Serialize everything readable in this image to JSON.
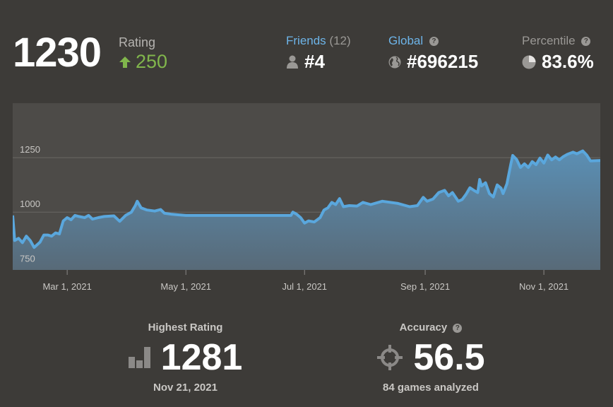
{
  "header": {
    "rating": "1230",
    "rating_label": "Rating",
    "rating_change": "250",
    "friends": {
      "label": "Friends",
      "count": "(12)",
      "value": "#4"
    },
    "global": {
      "label": "Global",
      "value": "#696215"
    },
    "percentile": {
      "label": "Percentile",
      "value": "83.6%"
    }
  },
  "chart_data": {
    "type": "area",
    "xlabel": "",
    "ylabel": "",
    "x_ticks": [
      "Mar 1, 2021",
      "May 1, 2021",
      "Jul 1, 2021",
      "Sep 1, 2021",
      "Nov 1, 2021"
    ],
    "y_ticks": [
      750,
      1000,
      1250
    ],
    "ylim": [
      735,
      1500
    ],
    "xlim": [
      "2021-02-01",
      "2021-11-30"
    ],
    "series": [
      {
        "points": [
          [
            "2021-02-01",
            985
          ],
          [
            "2021-02-02",
            870
          ],
          [
            "2021-02-04",
            880
          ],
          [
            "2021-02-06",
            860
          ],
          [
            "2021-02-08",
            890
          ],
          [
            "2021-02-10",
            870
          ],
          [
            "2021-02-12",
            838
          ],
          [
            "2021-02-15",
            862
          ],
          [
            "2021-02-17",
            895
          ],
          [
            "2021-02-19",
            895
          ],
          [
            "2021-02-21",
            890
          ],
          [
            "2021-02-23",
            905
          ],
          [
            "2021-02-25",
            900
          ],
          [
            "2021-02-27",
            960
          ],
          [
            "2021-03-01",
            975
          ],
          [
            "2021-03-03",
            965
          ],
          [
            "2021-03-05",
            985
          ],
          [
            "2021-03-07",
            980
          ],
          [
            "2021-03-10",
            975
          ],
          [
            "2021-03-12",
            985
          ],
          [
            "2021-03-14",
            968
          ],
          [
            "2021-03-17",
            975
          ],
          [
            "2021-03-20",
            980
          ],
          [
            "2021-03-25",
            983
          ],
          [
            "2021-03-28",
            958
          ],
          [
            "2021-03-31",
            985
          ],
          [
            "2021-04-03",
            1000
          ],
          [
            "2021-04-05",
            1030
          ],
          [
            "2021-04-06",
            1050
          ],
          [
            "2021-04-08",
            1020
          ],
          [
            "2021-04-11",
            1010
          ],
          [
            "2021-04-15",
            1005
          ],
          [
            "2021-04-18",
            1012
          ],
          [
            "2021-04-20",
            995
          ],
          [
            "2021-04-24",
            990
          ],
          [
            "2021-05-01",
            985
          ],
          [
            "2021-06-01",
            985
          ],
          [
            "2021-06-24",
            985
          ],
          [
            "2021-06-25",
            1000
          ],
          [
            "2021-06-27",
            990
          ],
          [
            "2021-06-29",
            975
          ],
          [
            "2021-07-01",
            950
          ],
          [
            "2021-07-03",
            960
          ],
          [
            "2021-07-06",
            955
          ],
          [
            "2021-07-09",
            975
          ],
          [
            "2021-07-11",
            1010
          ],
          [
            "2021-07-13",
            1020
          ],
          [
            "2021-07-15",
            1045
          ],
          [
            "2021-07-17",
            1035
          ],
          [
            "2021-07-19",
            1062
          ],
          [
            "2021-07-21",
            1025
          ],
          [
            "2021-07-24",
            1030
          ],
          [
            "2021-07-28",
            1028
          ],
          [
            "2021-07-31",
            1045
          ],
          [
            "2021-08-04",
            1035
          ],
          [
            "2021-08-10",
            1050
          ],
          [
            "2021-08-18",
            1040
          ],
          [
            "2021-08-24",
            1025
          ],
          [
            "2021-08-28",
            1030
          ],
          [
            "2021-08-31",
            1068
          ],
          [
            "2021-09-02",
            1050
          ],
          [
            "2021-09-05",
            1060
          ],
          [
            "2021-09-08",
            1090
          ],
          [
            "2021-09-11",
            1100
          ],
          [
            "2021-09-13",
            1075
          ],
          [
            "2021-09-15",
            1090
          ],
          [
            "2021-09-18",
            1050
          ],
          [
            "2021-09-20",
            1058
          ],
          [
            "2021-09-22",
            1082
          ],
          [
            "2021-09-24",
            1112
          ],
          [
            "2021-09-26",
            1100
          ],
          [
            "2021-09-28",
            1090
          ],
          [
            "2021-09-29",
            1150
          ],
          [
            "2021-09-30",
            1120
          ],
          [
            "2021-10-02",
            1135
          ],
          [
            "2021-10-04",
            1085
          ],
          [
            "2021-10-06",
            1070
          ],
          [
            "2021-10-08",
            1125
          ],
          [
            "2021-10-10",
            1110
          ],
          [
            "2021-10-11",
            1085
          ],
          [
            "2021-10-13",
            1130
          ],
          [
            "2021-10-15",
            1220
          ],
          [
            "2021-10-16",
            1260
          ],
          [
            "2021-10-18",
            1242
          ],
          [
            "2021-10-20",
            1205
          ],
          [
            "2021-10-22",
            1222
          ],
          [
            "2021-10-24",
            1205
          ],
          [
            "2021-10-26",
            1232
          ],
          [
            "2021-10-28",
            1218
          ],
          [
            "2021-10-30",
            1248
          ],
          [
            "2021-11-01",
            1225
          ],
          [
            "2021-11-03",
            1262
          ],
          [
            "2021-11-05",
            1240
          ],
          [
            "2021-11-07",
            1253
          ],
          [
            "2021-11-09",
            1240
          ],
          [
            "2021-11-11",
            1255
          ],
          [
            "2021-11-13",
            1265
          ],
          [
            "2021-11-16",
            1275
          ],
          [
            "2021-11-18",
            1268
          ],
          [
            "2021-11-21",
            1281
          ],
          [
            "2021-11-23",
            1262
          ],
          [
            "2021-11-25",
            1235
          ],
          [
            "2021-11-30",
            1237
          ]
        ]
      }
    ]
  },
  "highest": {
    "label": "Highest Rating",
    "value": "1281",
    "date": "Nov 21, 2021"
  },
  "accuracy": {
    "label": "Accuracy",
    "value": "56.5",
    "sub": "84 games analyzed"
  },
  "colors": {
    "accent_green": "#81b64c",
    "accent_blue": "#6db4e8",
    "line": "#5aa7dd"
  },
  "icons": [
    "arrow-up-icon",
    "user-icon",
    "globe-icon",
    "pie-icon",
    "help-icon",
    "bar-chart-icon",
    "crosshair-icon"
  ]
}
